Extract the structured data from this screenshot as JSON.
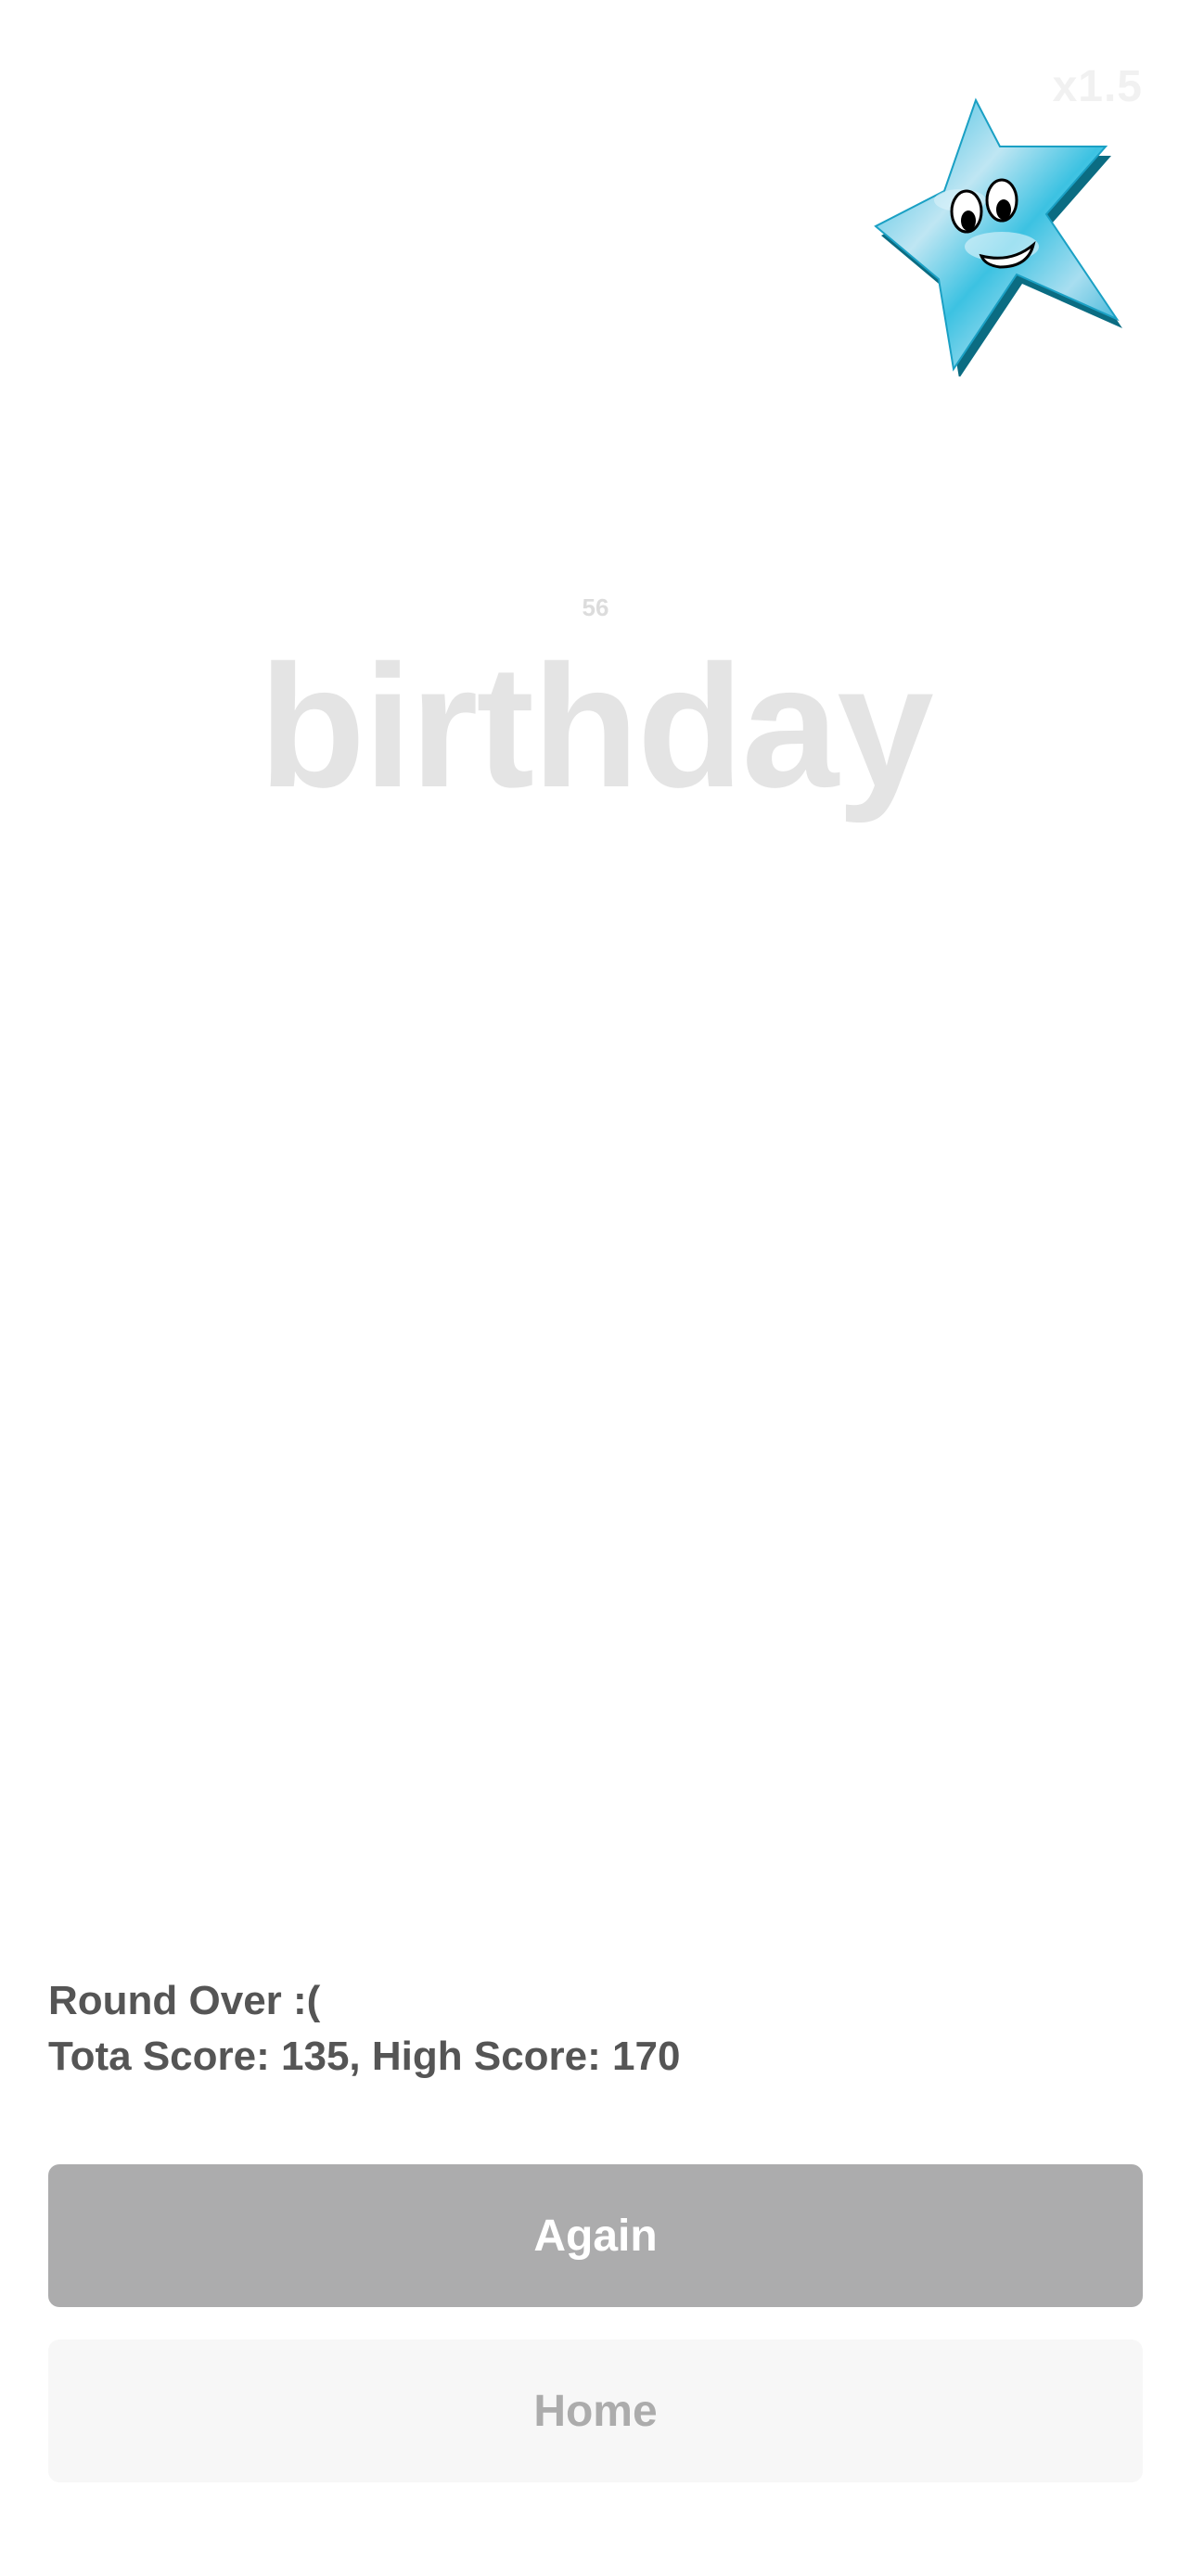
{
  "game": {
    "multiplier": "x1.5",
    "timer": "56",
    "word": "birthday"
  },
  "result": {
    "line1": "Round Over :(",
    "line2": "Tota Score: 135, High Score: 170"
  },
  "buttons": {
    "again_label": "Again",
    "home_label": "Home"
  },
  "colors": {
    "again_bg": "#acacad",
    "home_bg": "#f7f7f7",
    "star_blue": "#29b7d8",
    "star_shadow": "#0b6c82"
  },
  "icons": {
    "mascot": "smiling-star-mascot-icon"
  }
}
